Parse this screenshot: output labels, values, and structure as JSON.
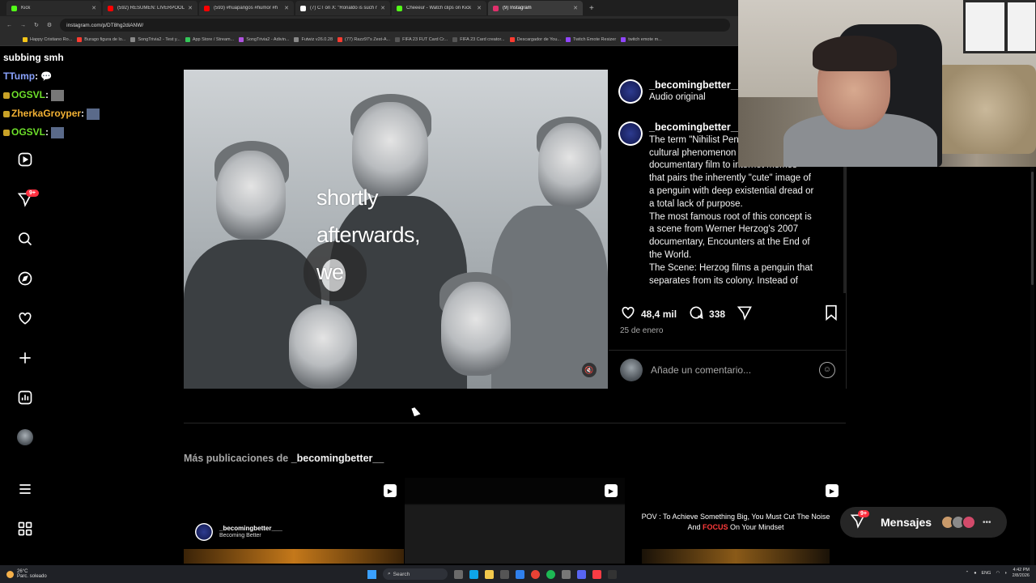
{
  "browser": {
    "tabs": [
      {
        "title": "Kick",
        "color": "#53fc18",
        "active": false
      },
      {
        "title": "(592) RESUMEN: LIVERPOOL 1",
        "color": "#ff0000",
        "active": false
      },
      {
        "title": "(593) #huapangos #humor #h",
        "color": "#ff0000",
        "active": false
      },
      {
        "title": "(7) CT on X: \"Ronaldo is such m",
        "color": "#ffffff",
        "active": false
      },
      {
        "title": "Cheeeur - Watch clips on Kick",
        "color": "#53fc18",
        "active": false
      },
      {
        "title": "(9) Instagram",
        "color": "#e1306c",
        "active": true
      }
    ],
    "url": "instagram.com/p/DT8hg2diANW/",
    "bookmarks": [
      "Happy Cristiano Ro...",
      "Burago figura de lo...",
      "SongTrivia2 - Test y...",
      "App Store / Stream...",
      "SongTrivia2 - Adivin...",
      "Futwiz v26.0.28",
      "(77) Razz97's Zest-A...",
      "FIFA 23 FUT Card Cr...",
      "FIFA 23 Card creator...",
      "Descargador de You...",
      "Twitch Emote Resizer",
      "twitch emote m..."
    ]
  },
  "chat": [
    {
      "user": "",
      "message": "subbing smh",
      "color": "#ffffff"
    },
    {
      "user": "TTump",
      "message": ":",
      "color": "#8aa3ff"
    },
    {
      "user": "OGSVL",
      "message": ":",
      "color": "#6ee02a"
    },
    {
      "user": "ZherkaGroyper",
      "message": ":",
      "color": "#f2b134"
    },
    {
      "user": "OGSVL",
      "message": ":",
      "color": "#6ee02a"
    }
  ],
  "nav": {
    "icons": [
      "home-icon",
      "reels-icon",
      "send-icon",
      "search-icon",
      "explore-icon",
      "heart-icon",
      "create-icon",
      "dashboard-icon",
      "profile-avatar",
      "menu-icon",
      "more-apps-icon"
    ],
    "notifications_badge": "9+"
  },
  "post": {
    "caption_overlay": [
      "shortly",
      "afterwards,",
      "we"
    ],
    "author": "_becomingbetter__",
    "audio": "Audio original",
    "caption_author": "_becomingbetter__",
    "caption_lines": [
      "The term \"Nihilist Pen",
      "cultural phenomenon",
      "documentary film to internet memes-",
      "that pairs the inherently \"cute\" image of",
      "a penguin with deep existential dread or",
      "a total lack of purpose.",
      "The most famous root of this concept is",
      "a scene from Werner Herzog's 2007",
      "documentary, Encounters at the End of",
      "the World.",
      "The Scene: Herzog films a penguin that",
      "separates from its colony. Instead of"
    ],
    "likes": "48,4 mil",
    "comments": "338",
    "date": "25 de enero",
    "comment_placeholder": "Añade un comentario..."
  },
  "more_posts": {
    "label_prefix": "Más publicaciones de ",
    "label_user": "_becomingbetter__",
    "thumb1": {
      "name": "_becomingbetter___",
      "sub": "Becoming Better"
    },
    "thumb3": {
      "text_before": "POV : To Achieve Something Big, You Must Cut The Noise And ",
      "focus": "FOCUS",
      "text_after": " On Your Mindset"
    }
  },
  "messages": {
    "label": "Mensajes",
    "badge": "9+"
  },
  "taskbar": {
    "weather_temp": "26°C",
    "weather_desc": "Parc. soleado",
    "search": "Search",
    "lang": "ENG",
    "time": "4:42 PM",
    "date": "2/8/2026"
  }
}
